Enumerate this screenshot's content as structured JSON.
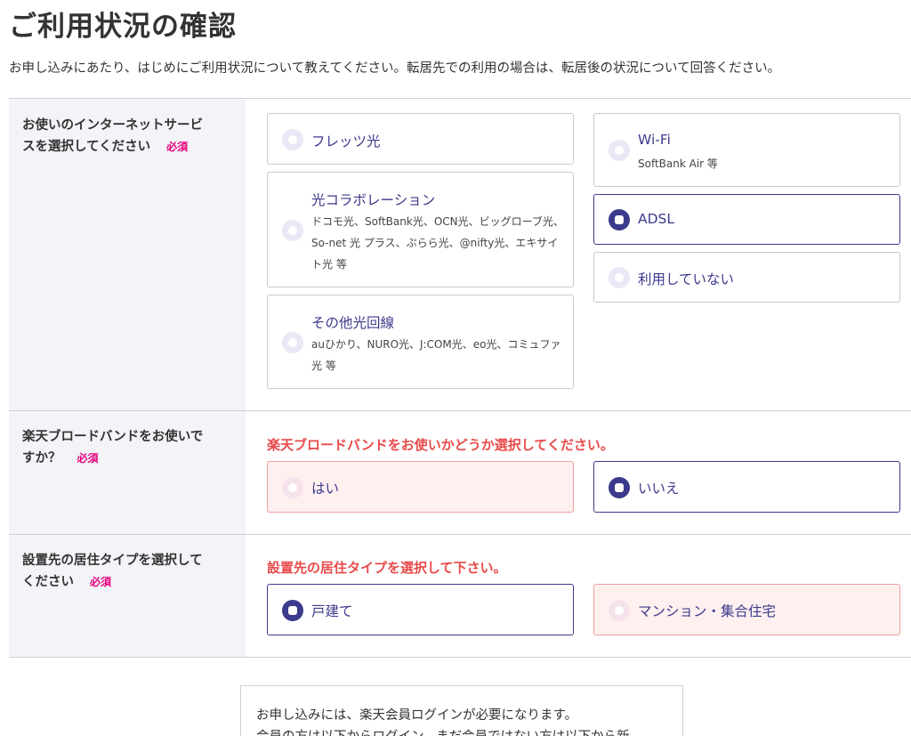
{
  "title": "ご利用状況の確認",
  "intro": "お申し込みにあたり、はじめにご利用状況について教えてください。転居先での利用の場合は、転居後の状況について回答ください。",
  "required_label": "必須",
  "section_internet": {
    "label_line1": "お使いのインターネットサービ",
    "label_line2": "スを選択してください",
    "options": [
      {
        "title": "フレッツ光",
        "desc": "",
        "selected": false
      },
      {
        "title": "光コラボレーション",
        "desc_line1": "ドコモ光、SoftBank光、OCN光、ビッグローブ光、",
        "desc_line2": "So-net 光 プラス、ぷらら光、@nifty光、エキサイ",
        "desc_line3": "ト光 等",
        "selected": false
      },
      {
        "title": "その他光回線",
        "desc_line1": "auひかり、NURO光、J:COM光、eo光、コミュファ",
        "desc_line2": "光 等",
        "selected": false
      },
      {
        "title": "Wi-Fi",
        "desc": "SoftBank Air 等",
        "selected": false
      },
      {
        "title": "ADSL",
        "desc": "",
        "selected": true
      },
      {
        "title": "利用していない",
        "desc": "",
        "selected": false
      }
    ]
  },
  "section_broadband": {
    "label_line1": "楽天ブロードバンドをお使いで",
    "label_line2": "すか？",
    "error": "楽天ブロードバンドをお使いかどうか選択してください。",
    "options": [
      {
        "title": "はい",
        "selected": false
      },
      {
        "title": "いいえ",
        "selected": true
      }
    ]
  },
  "section_residence": {
    "label_line1": "設置先の居住タイプを選択して",
    "label_line2": "ください",
    "error": "設置先の居住タイプを選択して下さい。",
    "options": [
      {
        "title": "戸建て",
        "selected": true
      },
      {
        "title": "マンション・集合住宅",
        "selected": false
      }
    ]
  },
  "notice": {
    "line1": "お申し込みには、楽天会員ログインが必要になります。",
    "line2": "会員の方は以下からログイン、まだ会員ではない方は以下から新"
  },
  "colors": {
    "accent": "#3c3a8c",
    "required": "#e6007e",
    "error": "#e84a4a"
  }
}
